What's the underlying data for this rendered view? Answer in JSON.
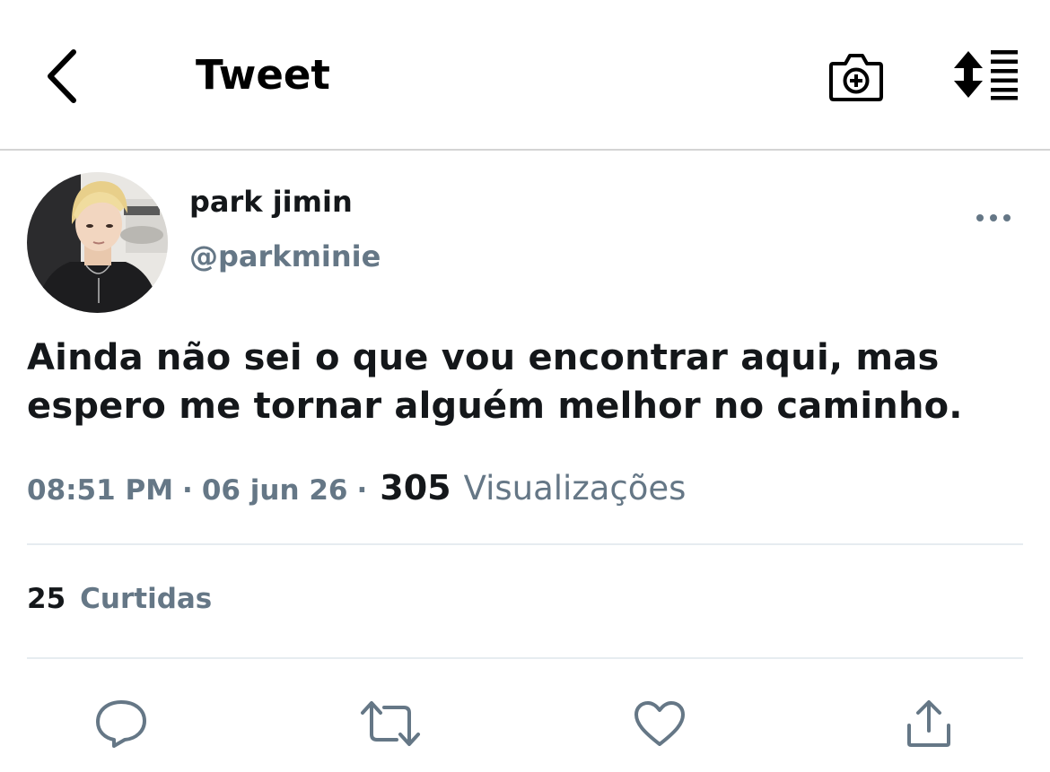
{
  "header": {
    "title": "Tweet",
    "back_icon": "chevron-left-icon",
    "camera_icon": "camera-plus-icon",
    "sort_icon": "sort-lines-icon"
  },
  "author": {
    "name": "park jimin",
    "handle": "@parkminie",
    "more_icon": "ellipsis-icon"
  },
  "tweet": {
    "text_line1": "Ainda não sei o que vou encontrar aqui, mas",
    "text_line2": "espero me tornar alguém melhor no caminho."
  },
  "meta": {
    "time": "08:51 PM",
    "separator": "·",
    "date": "06 jun 26",
    "views_count": "305",
    "views_label": "Visualizações"
  },
  "likes": {
    "count": "25",
    "label": "Curtidas"
  },
  "actions": {
    "reply_icon": "reply-icon",
    "retweet_icon": "retweet-icon",
    "like_icon": "heart-icon",
    "share_icon": "share-icon"
  },
  "colors": {
    "text_primary": "#14171a",
    "text_secondary": "#657786",
    "divider": "#e6ecf0"
  }
}
